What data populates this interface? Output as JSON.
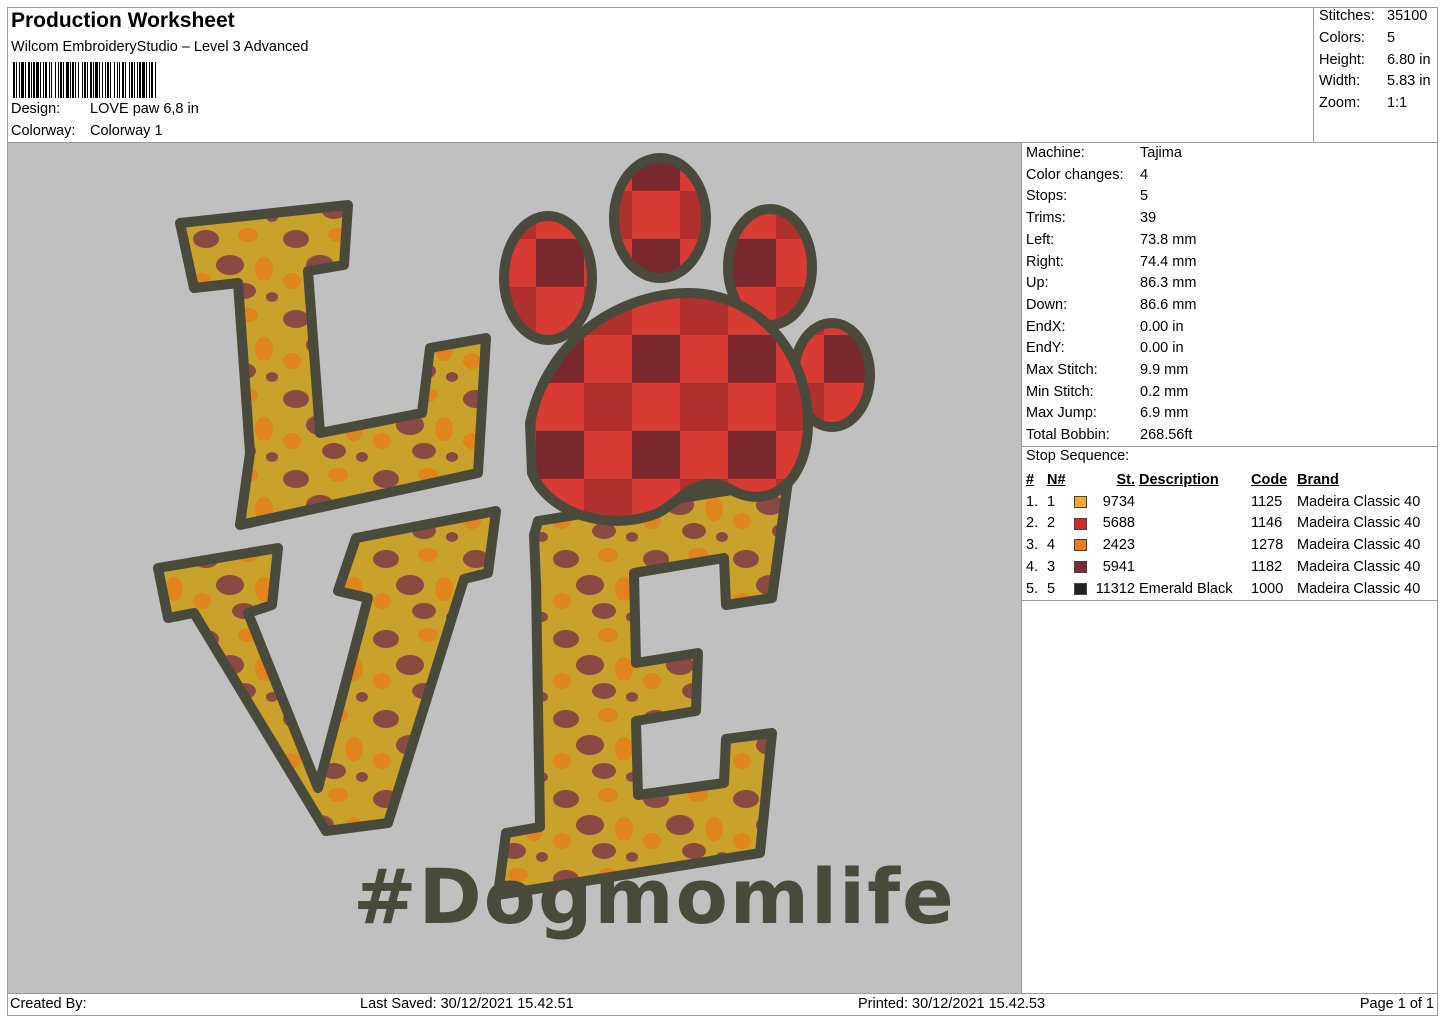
{
  "header": {
    "title": "Production Worksheet",
    "software": "Wilcom EmbroideryStudio – Level 3 Advanced",
    "design_label": "Design:",
    "design_value": "LOVE paw 6,8 in",
    "colorway_label": "Colorway:",
    "colorway_value": "Colorway 1"
  },
  "summary": {
    "stitches_label": "Stitches:",
    "stitches_value": "35100",
    "colors_label": "Colors:",
    "colors_value": "5",
    "height_label": "Height:",
    "height_value": "6.80 in",
    "width_label": "Width:",
    "width_value": "5.83 in",
    "zoom_label": "Zoom:",
    "zoom_value": "1:1"
  },
  "machine_info": [
    {
      "label": "Machine:",
      "value": "Tajima"
    },
    {
      "label": "Color changes:",
      "value": "4"
    },
    {
      "label": "Stops:",
      "value": "5"
    },
    {
      "label": "Trims:",
      "value": "39"
    },
    {
      "label": "Left:",
      "value": "73.8 mm"
    },
    {
      "label": "Right:",
      "value": "74.4 mm"
    },
    {
      "label": "Up:",
      "value": "86.3 mm"
    },
    {
      "label": "Down:",
      "value": "86.6 mm"
    },
    {
      "label": "EndX:",
      "value": "0.00 in"
    },
    {
      "label": "EndY:",
      "value": "0.00 in"
    },
    {
      "label": "Max Stitch:",
      "value": "9.9 mm"
    },
    {
      "label": "Min Stitch:",
      "value": "0.2 mm"
    },
    {
      "label": "Max Jump:",
      "value": "6.9 mm"
    },
    {
      "label": "Total Bobbin:",
      "value": "268.56ft"
    }
  ],
  "stop_sequence": {
    "label": "Stop Sequence:",
    "headers": [
      "#",
      "N#",
      "St.",
      "Description",
      "Code",
      "Brand"
    ],
    "rows": [
      {
        "num": "1.",
        "n": "1",
        "color": "#f0a830",
        "stitches": "9734",
        "description": "",
        "code": "1125",
        "brand": "Madeira Classic 40"
      },
      {
        "num": "2.",
        "n": "2",
        "color": "#d42a26",
        "stitches": "5688",
        "description": "",
        "code": "1146",
        "brand": "Madeira Classic 40"
      },
      {
        "num": "3.",
        "n": "4",
        "color": "#f07a1e",
        "stitches": "2423",
        "description": "",
        "code": "1278",
        "brand": "Madeira Classic 40"
      },
      {
        "num": "4.",
        "n": "3",
        "color": "#7a2a3a",
        "stitches": "5941",
        "description": "",
        "code": "1182",
        "brand": "Madeira Classic 40"
      },
      {
        "num": "5.",
        "n": "5",
        "color": "#222222",
        "stitches": "11312",
        "description": "Emerald Black",
        "code": "1000",
        "brand": "Madeira Classic 40"
      }
    ]
  },
  "design_preview": {
    "caption_text": "#Dogmomlife",
    "canvas_color": "#c0c0c0",
    "outline_color": "#4a4a3c",
    "leopard_base": "#c8a22a",
    "leopard_spot": "#8a4a44",
    "leopard_accent": "#e0841c",
    "plaid_red": "#d83a34",
    "plaid_dark": "#7a2a2e"
  },
  "footer": {
    "created_by": "Created By:",
    "last_saved": "Last Saved: 30/12/2021 15.42.51",
    "printed": "Printed: 30/12/2021 15.42.53",
    "page": "Page 1 of 1"
  }
}
